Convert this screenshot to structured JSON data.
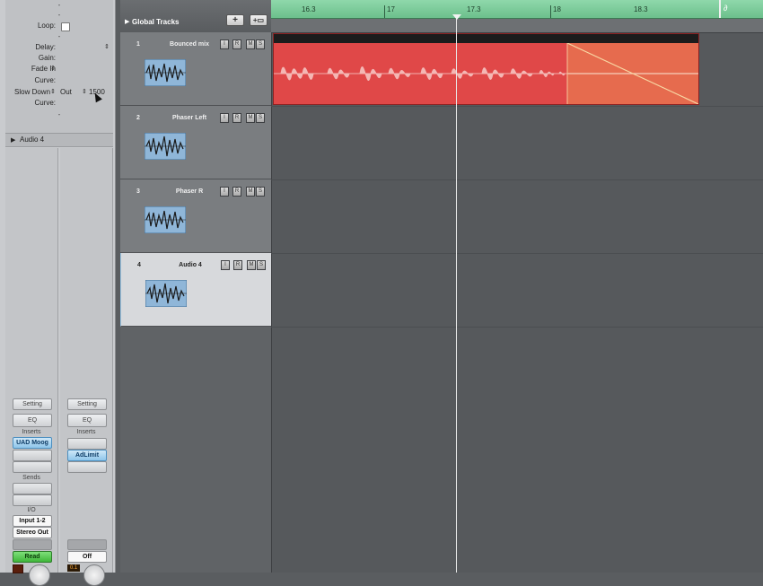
{
  "region_params": {
    "dash_top": "-",
    "dash_a": "-",
    "loop_label": "Loop:",
    "dash_b": "-",
    "delay_label": "Delay:",
    "gain_label": "Gain:",
    "fade_in_label": "Fade In",
    "curve1_label": "Curve:",
    "slow_down_label": "Slow Down",
    "out_label": "Out",
    "out_value": "1500",
    "curve2_label": "Curve:",
    "dash_bottom": "-"
  },
  "track_header": {
    "name": "Audio 4"
  },
  "strip1": {
    "setting": "Setting",
    "eq": "EQ",
    "inserts_label": "Inserts",
    "insert_slot1": "UAD Moog",
    "sends_label": "Sends",
    "io_label": "I/O",
    "input": "Input 1-2",
    "output": "Stereo Out",
    "automation": "Read"
  },
  "strip2": {
    "setting": "Setting",
    "eq": "EQ",
    "inserts_label": "Inserts",
    "insert_slot1": "AdLimit",
    "automation": "Off",
    "level": "0.1"
  },
  "global_tracks": {
    "label": "Global Tracks"
  },
  "tracks": [
    {
      "number": "1",
      "name": "Bounced mix"
    },
    {
      "number": "2",
      "name": "Phaser Left"
    },
    {
      "number": "3",
      "name": "Phaser R"
    },
    {
      "number": "4",
      "name": "Audio 4"
    }
  ],
  "track_buttons": {
    "input": "I",
    "record": "R",
    "mute": "M",
    "solo": "S"
  },
  "ruler": {
    "labels": [
      "16.3",
      "17",
      "17.3",
      "18",
      "18.3"
    ]
  },
  "colors": {
    "region": "#e04848",
    "fade": "#e66b4e",
    "ruler": "#7ccd9b",
    "insert_blue": "#8ec5ea",
    "read_green": "#3fb63a"
  },
  "icons": {
    "add_track": "plus-icon",
    "add_folder": "folder-plus-icon",
    "end_marker": "end-flag-icon",
    "playhead": "playhead-icon"
  }
}
